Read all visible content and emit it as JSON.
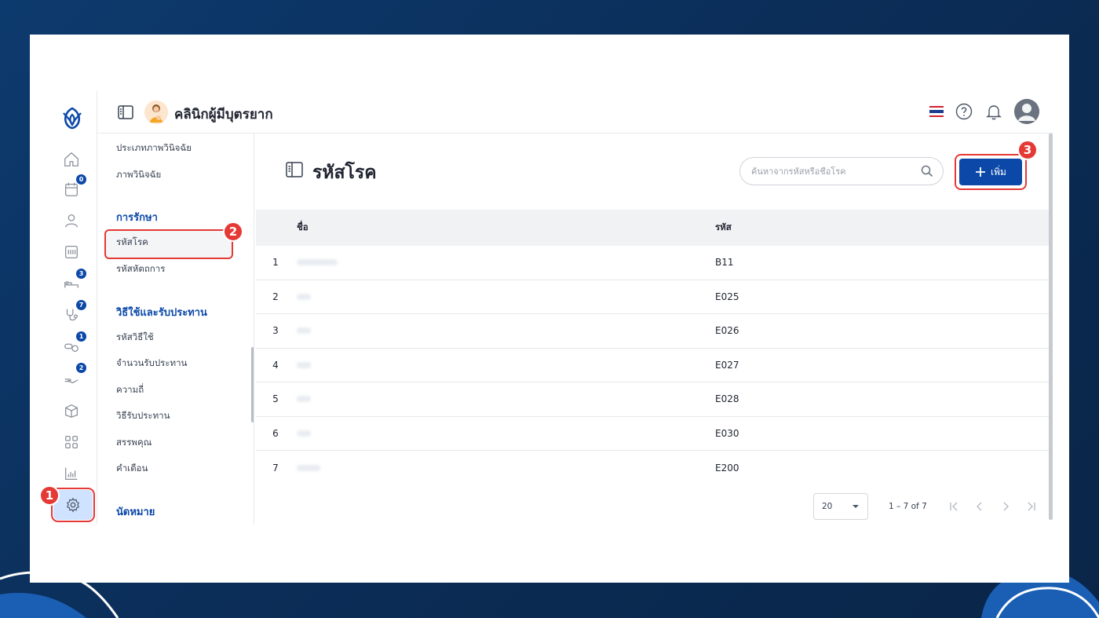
{
  "header": {
    "clinic_name": "คลินิกผู้มีบุตรยาก"
  },
  "rail": {
    "items": [
      {
        "name": "home-icon",
        "badge": null
      },
      {
        "name": "calendar-icon",
        "badge": "0"
      },
      {
        "name": "user-icon",
        "badge": null
      },
      {
        "name": "scanner-icon",
        "badge": null
      },
      {
        "name": "bed-icon",
        "badge": "3"
      },
      {
        "name": "stethoscope-icon",
        "badge": "7"
      },
      {
        "name": "pills-icon",
        "badge": "1"
      },
      {
        "name": "hand-icon",
        "badge": "2"
      },
      {
        "name": "package-icon",
        "badge": null
      },
      {
        "name": "apps-icon",
        "badge": null
      },
      {
        "name": "report-icon",
        "badge": null
      },
      {
        "name": "settings-icon",
        "badge": null
      }
    ],
    "badges": {
      "calendar": "0",
      "bed": "3",
      "stethoscope": "7",
      "pills": "1",
      "hand": "2"
    }
  },
  "submenu": {
    "item_imaging_type": "ประเภทภาพวินิจฉัย",
    "item_imaging": "ภาพวินิจฉัย",
    "group_treatment": "การรักษา",
    "item_disease_code": "รหัสโรค",
    "item_procedure_code": "รหัสหัตถการ",
    "group_usage": "วิธีใช้และรับประทาน",
    "item_usage_code": "รหัสวิธีใช้",
    "item_dose_amount": "จำนวนรับประทาน",
    "item_frequency": "ความถี่",
    "item_method": "วิธีรับประทาน",
    "item_properties": "สรรพคุณ",
    "item_warning": "คำเตือน",
    "group_appointment": "นัดหมาย"
  },
  "main": {
    "title": "รหัสโรค",
    "search_placeholder": "ค้นหาจากรหัสหรือชื่อโรค",
    "add_label": "เพิ่ม",
    "columns": {
      "name": "ชื่อ",
      "code": "รหัส"
    },
    "rows": [
      {
        "index": "1",
        "code": "B11"
      },
      {
        "index": "2",
        "code": "E025"
      },
      {
        "index": "3",
        "code": "E026"
      },
      {
        "index": "4",
        "code": "E027"
      },
      {
        "index": "5",
        "code": "E028"
      },
      {
        "index": "6",
        "code": "E030"
      },
      {
        "index": "7",
        "code": "E200"
      }
    ],
    "pagination": {
      "page_size": "20",
      "range_label": "1 – 7 of 7"
    }
  },
  "steps": {
    "one": "1",
    "two": "2",
    "three": "3"
  },
  "colors": {
    "primary": "#0b48a8",
    "highlight": "#e53935",
    "background": "#0b2d57"
  }
}
